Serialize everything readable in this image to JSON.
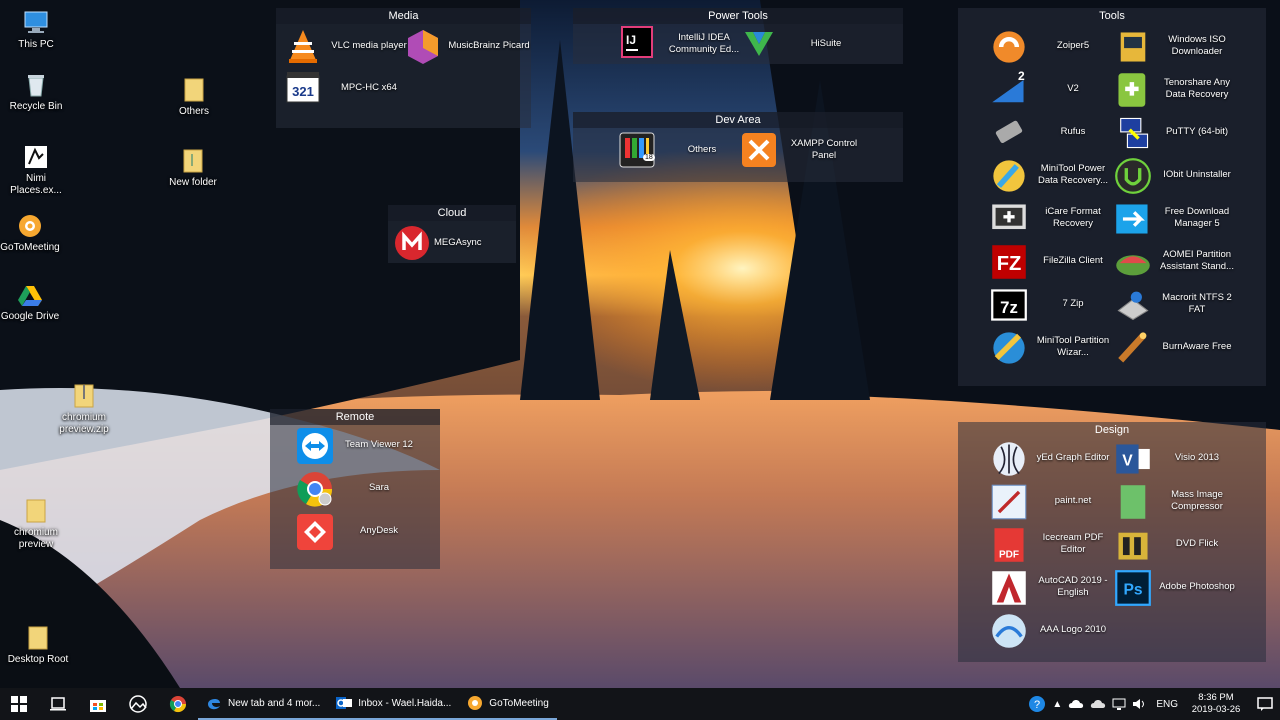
{
  "desktop": {
    "icons": [
      {
        "label": "This PC",
        "icon": "computer-icon"
      },
      {
        "label": "Recycle Bin",
        "icon": "recycle-bin-icon"
      },
      {
        "label": "Nimi Places.ex...",
        "icon": "nimi-places-icon"
      },
      {
        "label": "GoToMeeting",
        "icon": "gotomeeting-icon"
      },
      {
        "label": "Google Drive",
        "icon": "google-drive-icon"
      },
      {
        "label": "chromium preview.zip",
        "icon": "zip-folder-icon"
      },
      {
        "label": "chromium preview",
        "icon": "folder-icon"
      },
      {
        "label": "Desktop Root",
        "icon": "folder-icon"
      },
      {
        "label": "Others",
        "icon": "folder-icon"
      },
      {
        "label": "New folder",
        "icon": "folder-icon"
      }
    ]
  },
  "fences": {
    "media": {
      "title": "Media",
      "items": [
        "VLC media player",
        "MusicBrainz Picard",
        "MPC-HC x64"
      ]
    },
    "power_tools": {
      "title": "Power Tools",
      "items": [
        "IntelliJ IDEA Community Ed...",
        "HiSuite"
      ]
    },
    "dev_area": {
      "title": "Dev Area",
      "items": [
        "Others",
        "XAMPP Control Panel"
      ],
      "badge": "18"
    },
    "cloud": {
      "title": "Cloud",
      "items": [
        "MEGAsync"
      ]
    },
    "remote": {
      "title": "Remote",
      "items": [
        "Team Viewer 12",
        "Sara",
        "AnyDesk"
      ]
    },
    "tools": {
      "title": "Tools",
      "items": [
        "Zoiper5",
        "Windows ISO Downloader",
        "V2",
        "Tenorshare Any Data Recovery",
        "Rufus",
        "PuTTY (64-bit)",
        "MiniTool Power Data Recovery...",
        "IObit Uninstaller",
        "iCare Format Recovery",
        "Free Download Manager 5",
        "FileZilla Client",
        "AOMEI Partition Assistant Stand...",
        "7 Zip",
        "Macrorit NTFS 2 FAT",
        "MiniTool Partition Wizar...",
        "BurnAware Free"
      ],
      "v2_badge": "2"
    },
    "design": {
      "title": "Design",
      "items": [
        "yEd Graph Editor",
        "Visio 2013",
        "paint.net",
        "Mass Image Compressor",
        "Icecream PDF Editor",
        "DVD Flick",
        "AutoCAD 2019 - English",
        "Adobe Photoshop",
        "AAA Logo 2010"
      ]
    }
  },
  "taskbar": {
    "apps": [
      "New tab and 4 mor...",
      "Inbox - Wael.Haida...",
      "GoToMeeting"
    ],
    "tray": {
      "language": "ENG",
      "time": "8:36 PM",
      "date": "2019-03-26"
    }
  },
  "colors": {
    "accent": "#7aa7d8",
    "taskbar": "#121418",
    "fence": "#282e3c"
  }
}
